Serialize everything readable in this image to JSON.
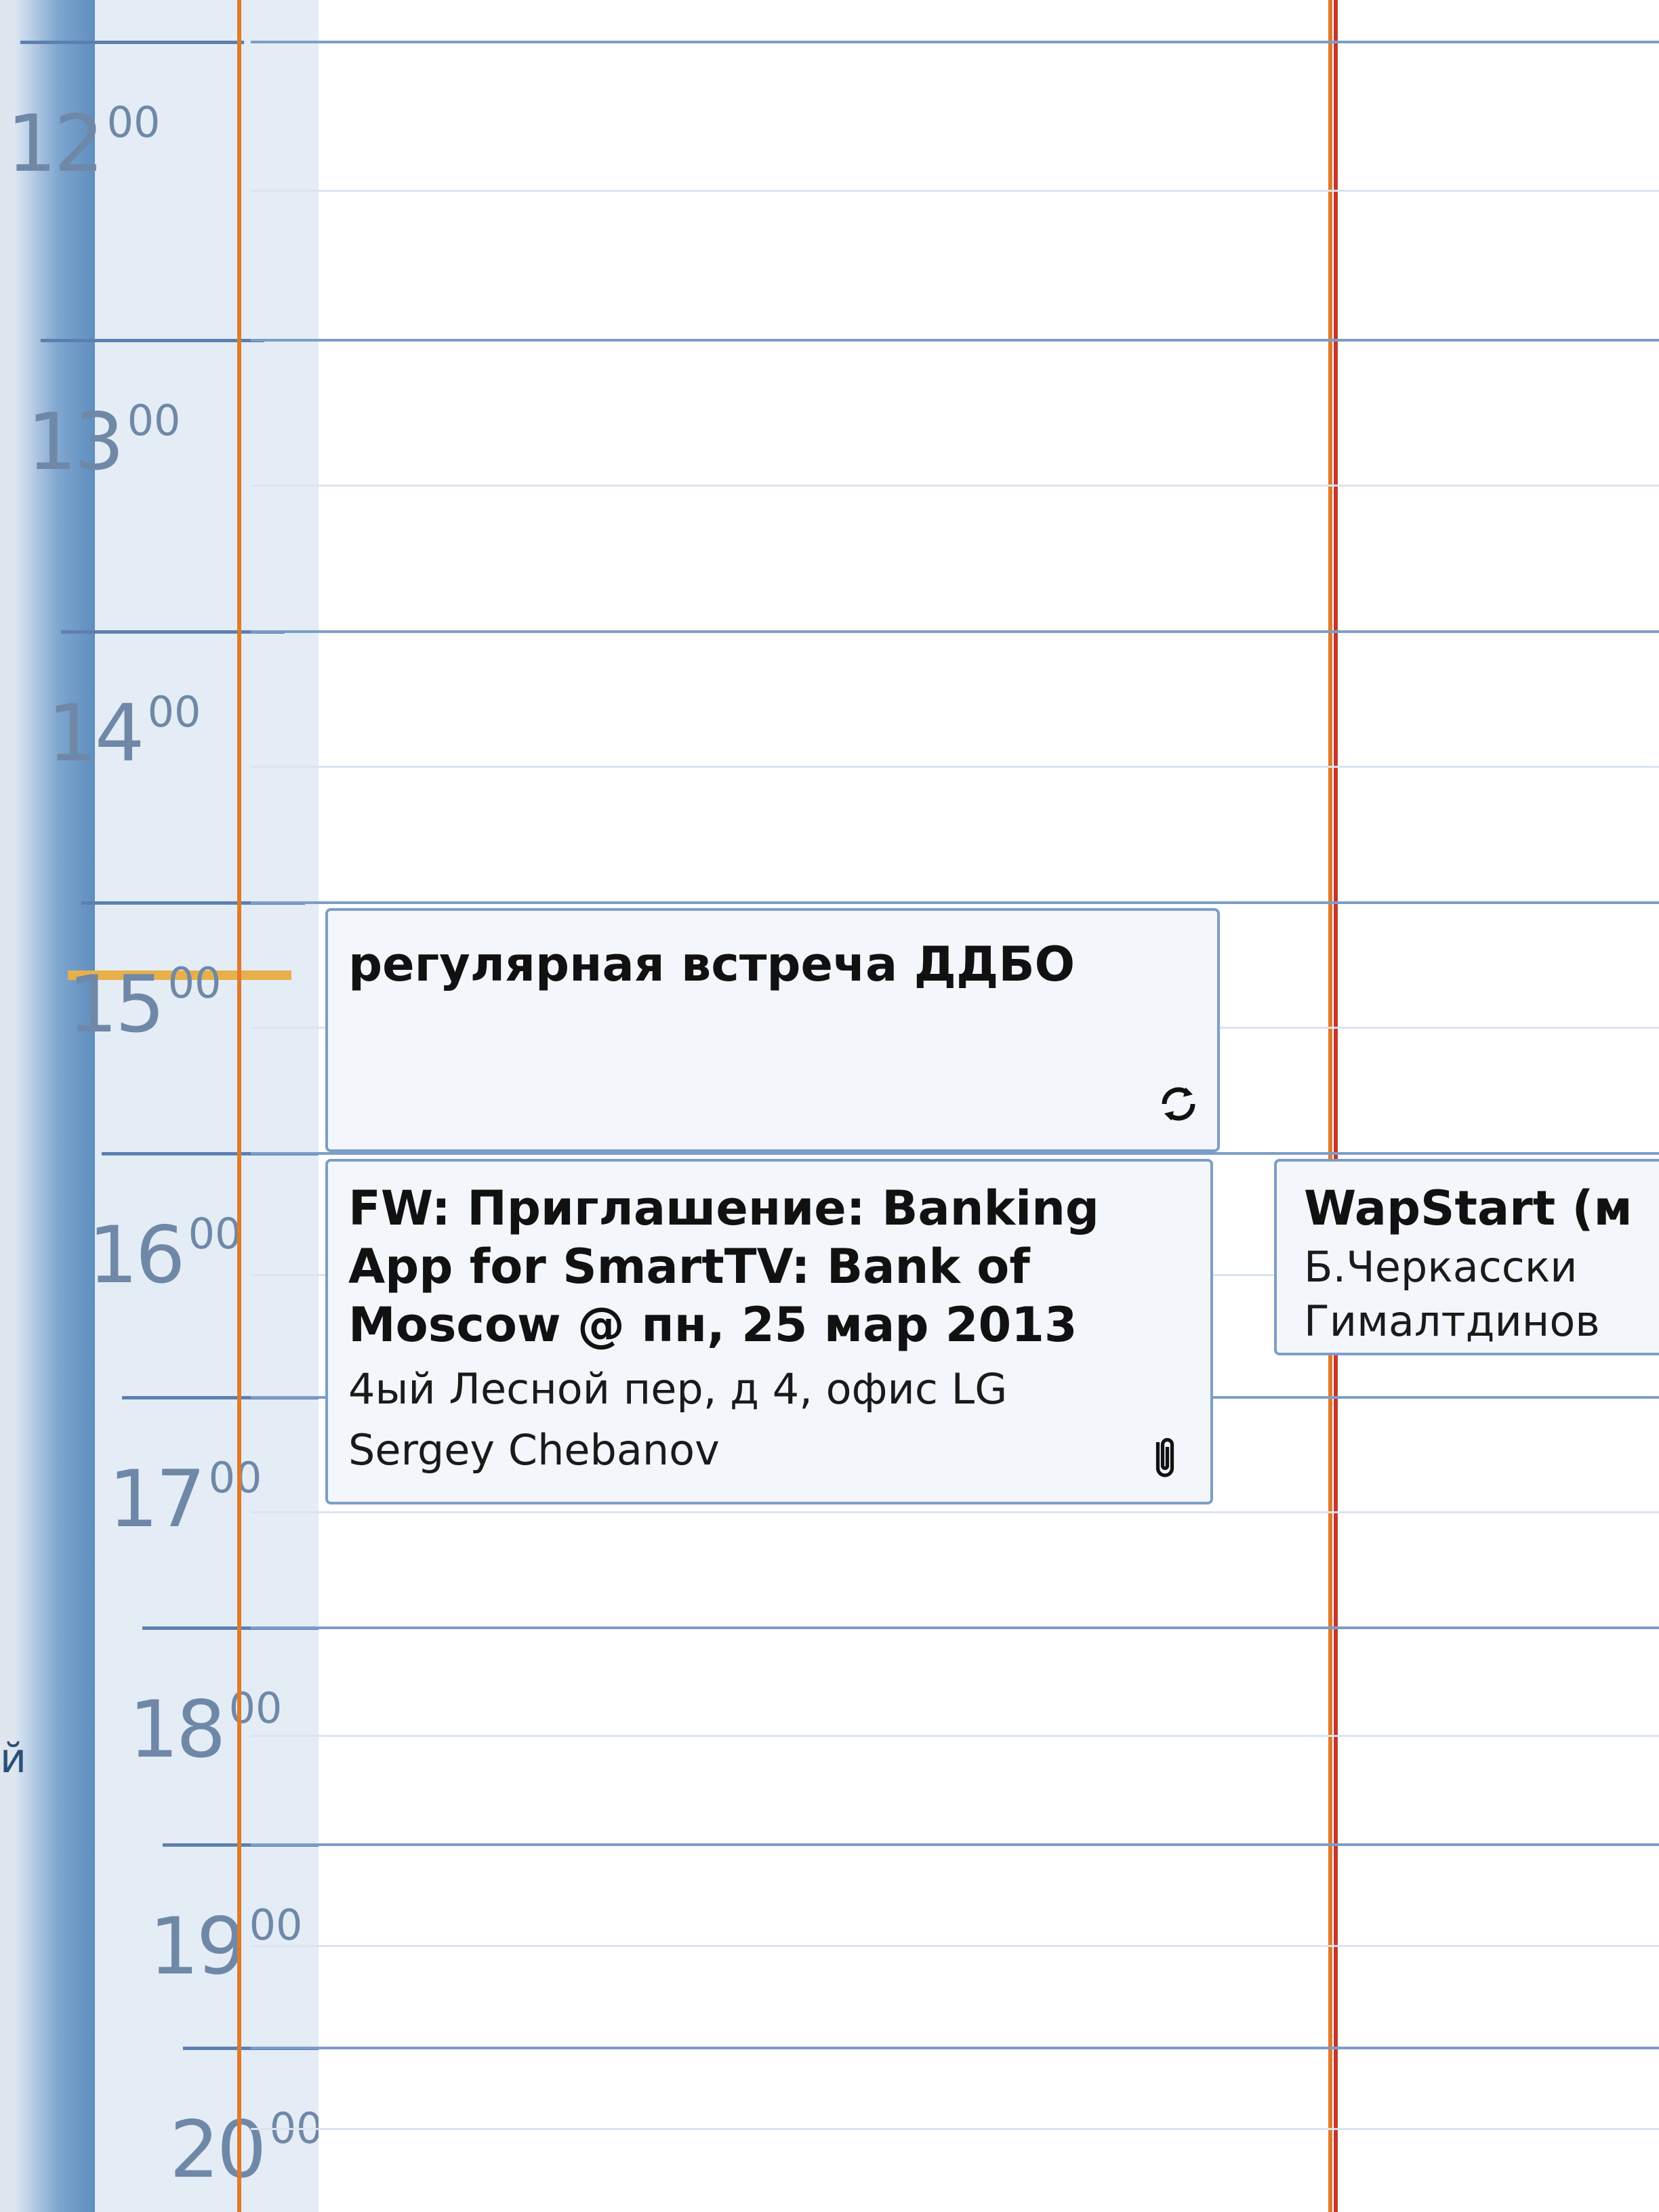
{
  "calendar": {
    "hours": [
      {
        "hour": "12",
        "minutes": "00"
      },
      {
        "hour": "13",
        "minutes": "00"
      },
      {
        "hour": "14",
        "minutes": "00"
      },
      {
        "hour": "15",
        "minutes": "00"
      },
      {
        "hour": "16",
        "minutes": "00"
      },
      {
        "hour": "17",
        "minutes": "00"
      },
      {
        "hour": "18",
        "minutes": "00"
      },
      {
        "hour": "19",
        "minutes": "00"
      },
      {
        "hour": "20",
        "minutes": "00"
      }
    ],
    "left_fragment": "й"
  },
  "appointments": [
    {
      "title": "регулярная встреча ДДБО",
      "icon": "recurring-icon"
    },
    {
      "lines": [
        "FW: Приглашение: Banking",
        "App for SmartTV: Bank of",
        "Moscow @ пн, 25 мар 2013"
      ],
      "location": "4ый Лесной пер, д 4, офис LG",
      "organizer": "Sergey Chebanov",
      "icon": "paperclip-icon"
    },
    {
      "title": "WapStart (м",
      "line2": "Б.Черкасски",
      "line3": "Гималтдинов"
    }
  ],
  "colors": {
    "accent_orange": "#e07a2a",
    "today_red": "#c7362b",
    "grid_blue": "#7d9dc7",
    "now_marker": "#e8b04a"
  }
}
